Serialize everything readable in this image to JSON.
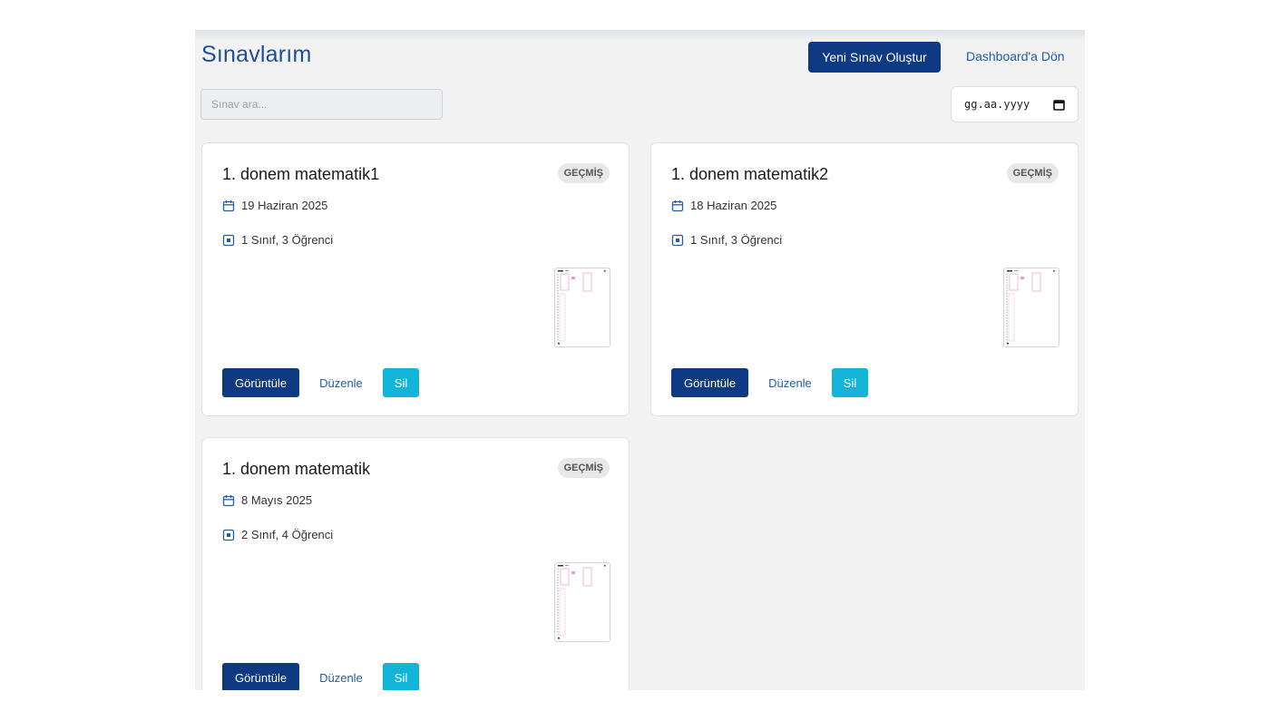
{
  "header": {
    "title": "Sınavlarım",
    "create_button": "Yeni Sınav Oluştur",
    "dashboard_link": "Dashboard'a Dön"
  },
  "filters": {
    "search_placeholder": "Sınav ara...",
    "date_placeholder": "gg.aa.yyyy"
  },
  "colors": {
    "primary": "#0d3a82",
    "accent": "#12b5d8",
    "link": "#1f5fa8",
    "title": "#1f4e96"
  },
  "icons": {
    "date": "calendar-icon",
    "classes": "classroom-icon",
    "date_picker": "calendar-picker-icon"
  },
  "exams": [
    {
      "title": "1. donem matematik1",
      "status": "GEÇMİŞ",
      "date": "19 Haziran 2025",
      "summary": "1 Sınıf, 3 Öğrenci",
      "view_label": "Görüntüle",
      "edit_label": "Düzenle",
      "delete_label": "Sil"
    },
    {
      "title": "1. donem matematik2",
      "status": "GEÇMİŞ",
      "date": "18 Haziran 2025",
      "summary": "1 Sınıf, 3 Öğrenci",
      "view_label": "Görüntüle",
      "edit_label": "Düzenle",
      "delete_label": "Sil"
    },
    {
      "title": "1. donem matematik",
      "status": "GEÇMİŞ",
      "date": "8 Mayıs 2025",
      "summary": "2 Sınıf, 4 Öğrenci",
      "view_label": "Görüntüle",
      "edit_label": "Düzenle",
      "delete_label": "Sil"
    }
  ]
}
